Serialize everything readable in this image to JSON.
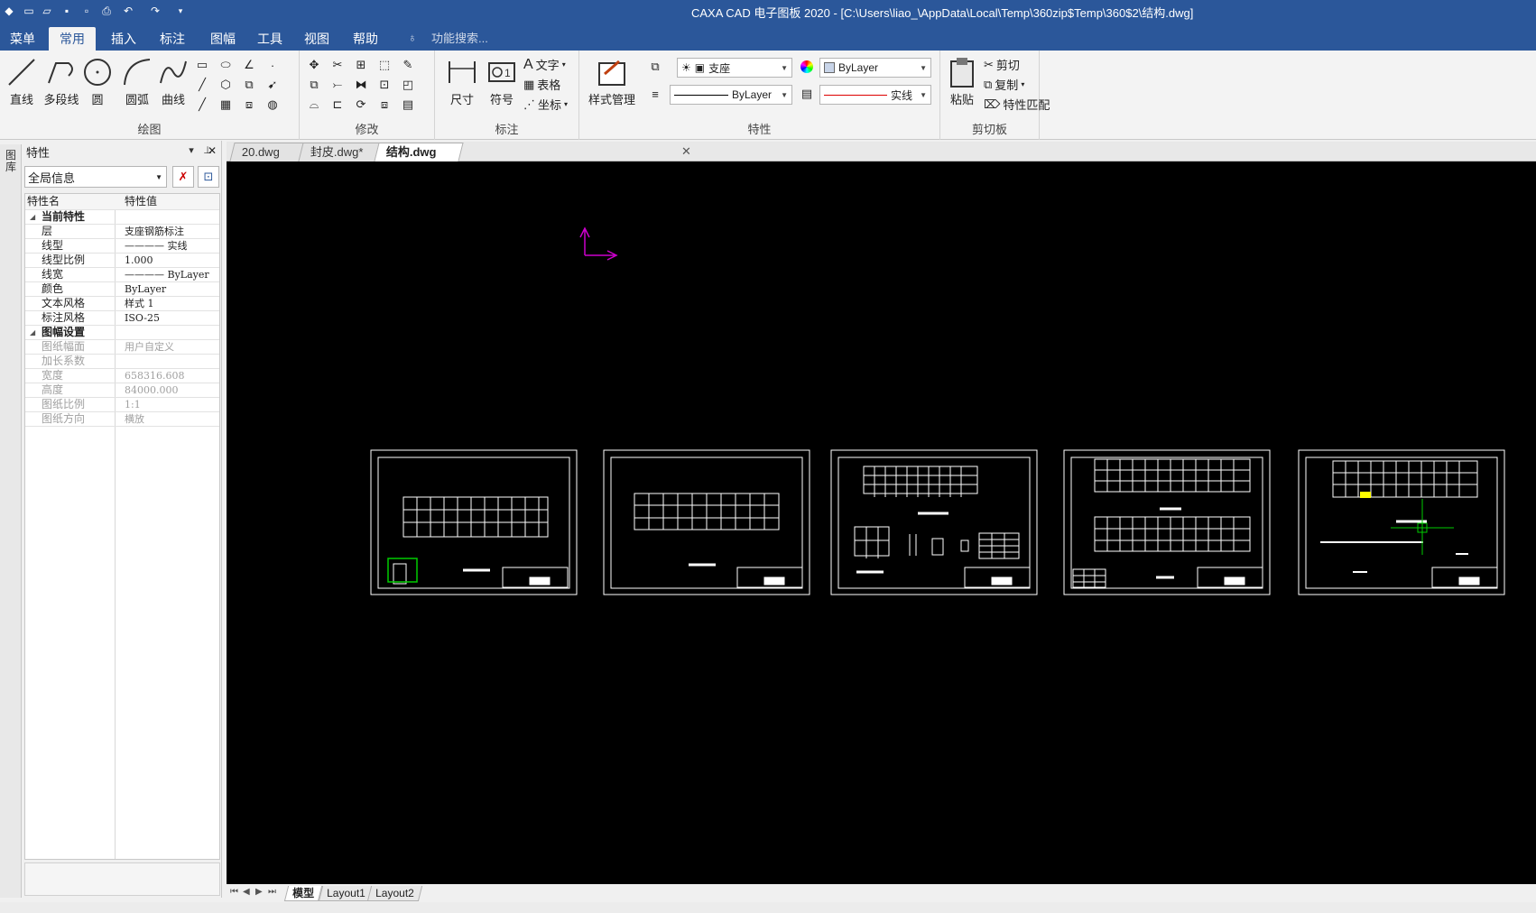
{
  "window": {
    "title": "CAXA CAD 电子图板 2020 - [C:\\Users\\liao_\\AppData\\Local\\Temp\\360zip$Temp\\360$2\\结构.dwg]"
  },
  "menu": {
    "tabs": [
      "菜单",
      "常用",
      "插入",
      "标注",
      "图幅",
      "工具",
      "视图",
      "帮助"
    ],
    "active": "常用",
    "search": "功能搜索..."
  },
  "ribbon": {
    "draw": {
      "label": "绘图",
      "line": "直线",
      "polyline": "多段线",
      "circle": "圆",
      "arc": "圆弧",
      "curve": "曲线"
    },
    "modify": {
      "label": "修改"
    },
    "annotate": {
      "label": "标注",
      "dimension": "尺寸",
      "symbol": "符号",
      "text": "文字",
      "table": "表格",
      "coord": "坐标"
    },
    "properties": {
      "label": "特性",
      "style_mgr": "样式管理",
      "layer": "支座",
      "color": "ByLayer",
      "linetype": "ByLayer",
      "linestyle": "实线"
    },
    "clipboard": {
      "label": "剪切板",
      "paste": "粘贴",
      "cut": "剪切",
      "copy": "复制",
      "match": "特性匹配"
    }
  },
  "side": {
    "strip_label": "图库"
  },
  "panel": {
    "title": "特性",
    "scope": "全局信息",
    "col_name": "特性名",
    "col_value": "特性值",
    "cat_current": "当前特性",
    "rows_current": [
      {
        "k": "层",
        "v": "支座钢筋标注"
      },
      {
        "k": "线型",
        "v": "———— 实线"
      },
      {
        "k": "线型比例",
        "v": "1.000"
      },
      {
        "k": "线宽",
        "v": "———— ByLayer"
      },
      {
        "k": "颜色",
        "v": "ByLayer"
      },
      {
        "k": "文本风格",
        "v": "样式 1"
      },
      {
        "k": "标注风格",
        "v": "ISO-25"
      }
    ],
    "cat_sheet": "图幅设置",
    "rows_sheet": [
      {
        "k": "图纸幅面",
        "v": "用户自定义"
      },
      {
        "k": "加长系数",
        "v": ""
      },
      {
        "k": "宽度",
        "v": "658316.608"
      },
      {
        "k": "高度",
        "v": "84000.000"
      },
      {
        "k": "图纸比例",
        "v": "1:1"
      },
      {
        "k": "图纸方向",
        "v": "横放"
      }
    ]
  },
  "doc_tabs": [
    "20.dwg",
    "封皮.dwg*",
    "结构.dwg"
  ],
  "active_doc": "结构.dwg",
  "layout_tabs": [
    "模型",
    "Layout1",
    "Layout2"
  ],
  "active_layout": "模型",
  "colors": {
    "titlebar": "#2b579a",
    "canvas": "#000000",
    "ucs": "#cc00cc",
    "highlight": "#00cc00",
    "marker": "#ffff00"
  }
}
